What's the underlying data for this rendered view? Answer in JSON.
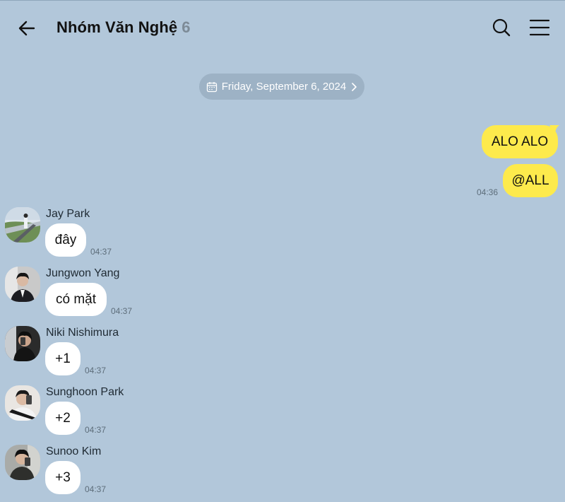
{
  "header": {
    "title": "Nhóm Văn Nghệ",
    "member_count": "6"
  },
  "date_divider": {
    "label": "Friday, September 6, 2024"
  },
  "my_messages": [
    {
      "text": "ALO ALO"
    },
    {
      "text": "@ALL",
      "time": "04:36"
    }
  ],
  "messages": [
    {
      "sender": "Jay Park",
      "text": "đây",
      "time": "04:37",
      "avatar": "photo-railway-landscape"
    },
    {
      "sender": "Jungwon Yang",
      "text": "có mặt",
      "time": "04:37",
      "avatar": "photo-man-in-suit"
    },
    {
      "sender": "Niki Nishimura",
      "text": "+1",
      "time": "04:37",
      "avatar": "photo-mirror-selfie-dark"
    },
    {
      "sender": "Sunghoon Park",
      "text": "+2",
      "time": "04:37",
      "avatar": "photo-mirror-selfie-phone"
    },
    {
      "sender": "Sunoo Kim",
      "text": "+3",
      "time": "04:37",
      "avatar": "photo-mirror-selfie-light"
    }
  ],
  "colors": {
    "background": "#b2c7da",
    "my_bubble": "#fdea4c",
    "their_bubble": "#ffffff",
    "date_pill": "#9db2c5"
  }
}
